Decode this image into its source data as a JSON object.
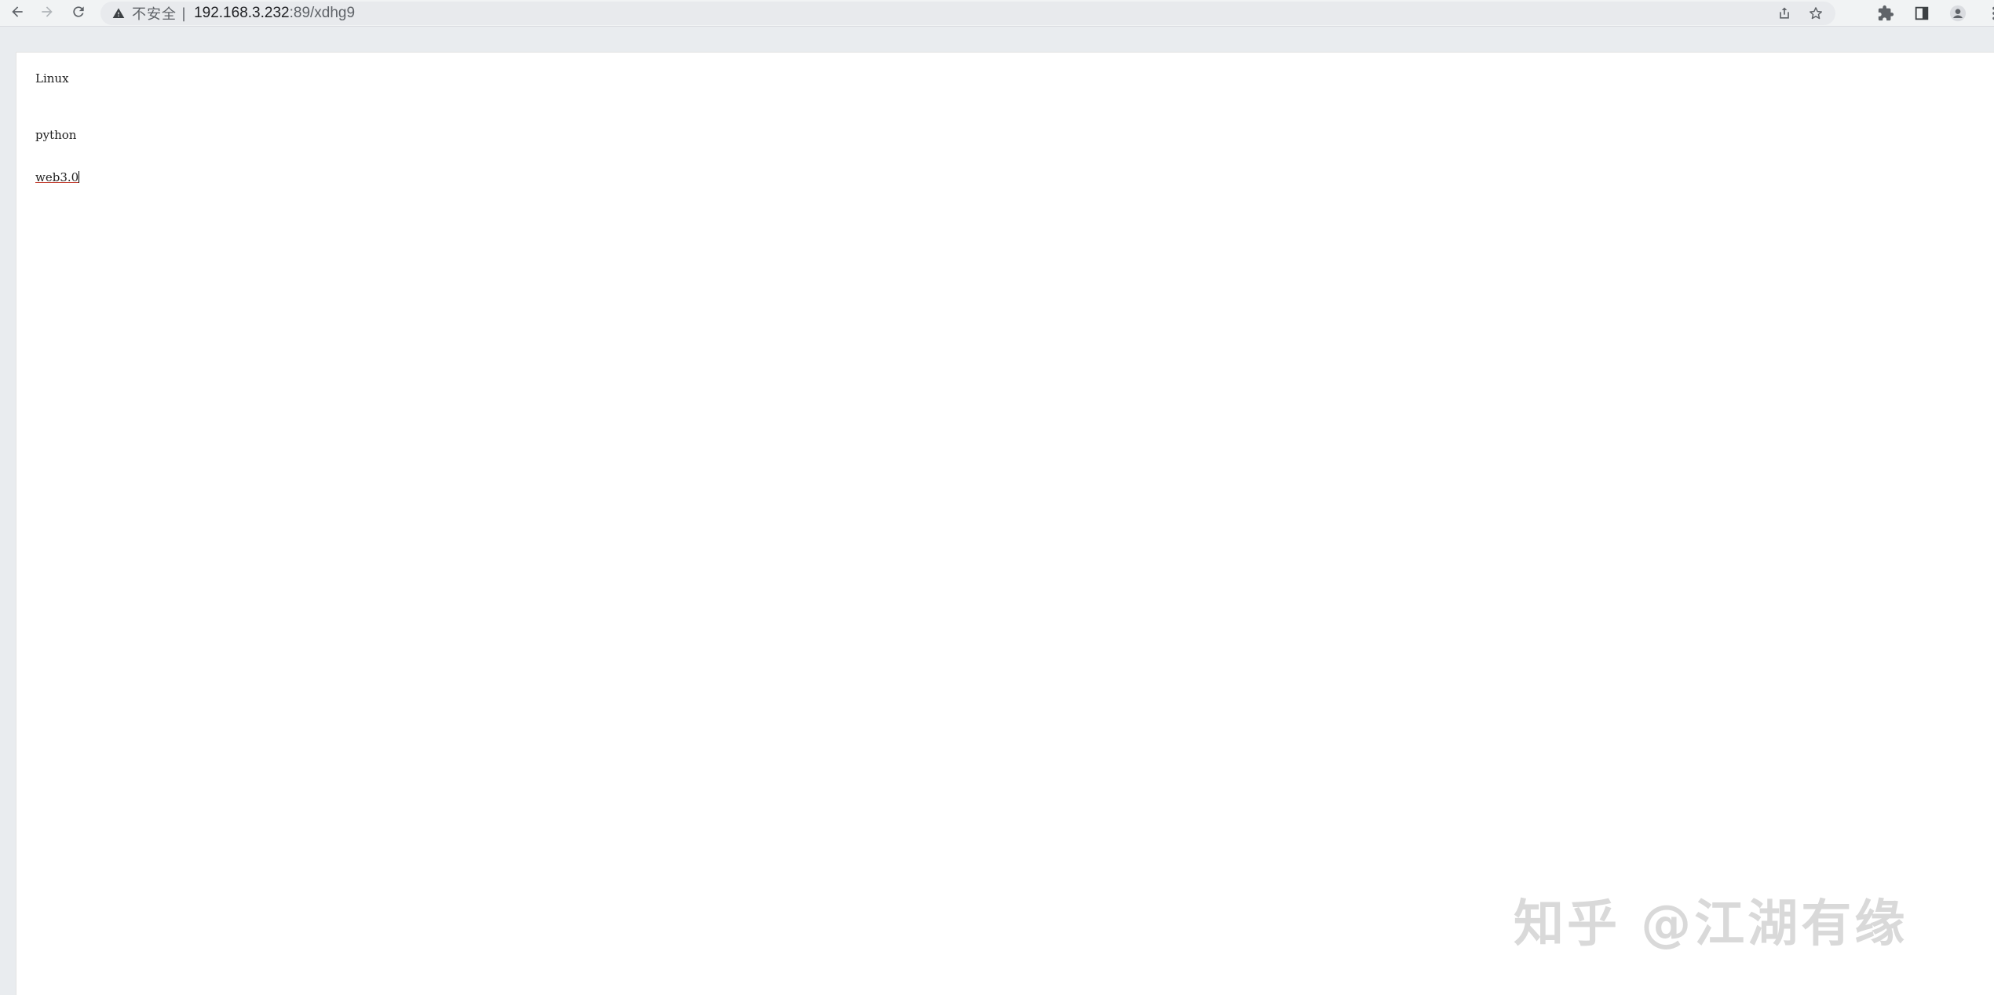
{
  "browser": {
    "security_label": "不安全",
    "url_separator": "|",
    "url_host": "192.168.3.232",
    "url_rest": ":89/xdhg9",
    "icons": {
      "back": "arrow-left-icon",
      "forward": "arrow-right-icon",
      "reload": "reload-icon",
      "warning": "warning-triangle-icon",
      "share": "share-icon",
      "bookmark": "star-icon",
      "extensions": "puzzle-icon",
      "side_panel": "side-panel-icon",
      "profile": "profile-icon",
      "menu": "kebab-menu-icon"
    }
  },
  "content": {
    "items": [
      {
        "label": "Linux"
      },
      {
        "label": "python"
      },
      {
        "label": "web3.0"
      }
    ]
  },
  "watermark": {
    "text": "知乎 @江湖有缘"
  },
  "colors": {
    "toolbar_bg": "#f1f3f4",
    "omnibox_bg": "#e8eaed",
    "page_bg": "#ffffff",
    "outer_bg": "#e9ecef",
    "link_underline": "#c0392b"
  }
}
